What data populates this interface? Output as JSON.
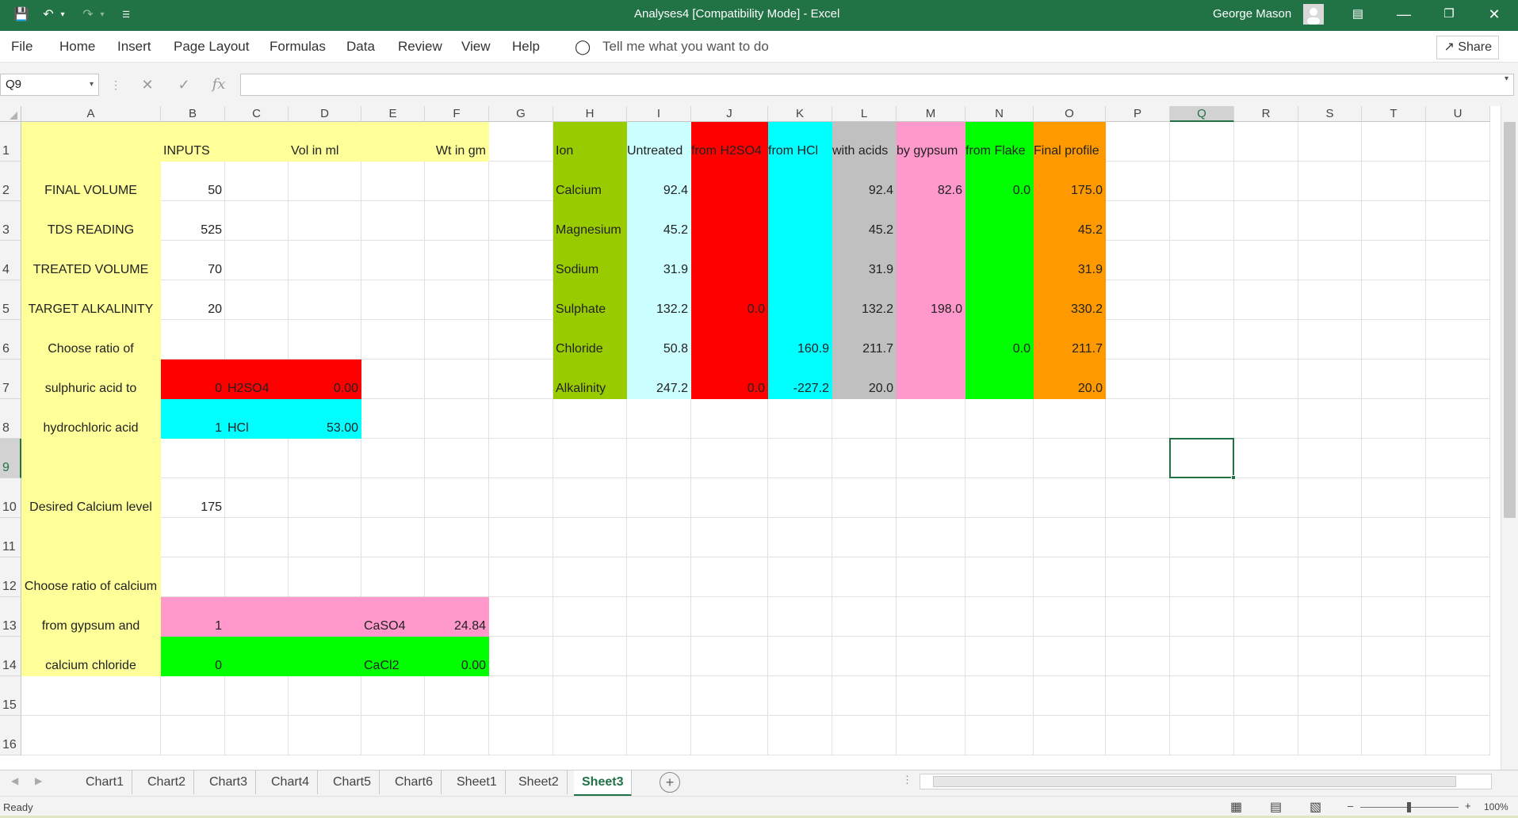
{
  "window": {
    "title": "Analyses4  [Compatibility Mode]  -  Excel",
    "user": "George Mason"
  },
  "menu": {
    "file": "File",
    "home": "Home",
    "insert": "Insert",
    "page_layout": "Page Layout",
    "formulas": "Formulas",
    "data": "Data",
    "review": "Review",
    "view": "View",
    "help": "Help",
    "tell_me": "Tell me what you want to do",
    "share": "Share"
  },
  "formula_bar": {
    "name_box": "Q9",
    "formula": ""
  },
  "columns": [
    "A",
    "B",
    "C",
    "D",
    "E",
    "F",
    "G",
    "H",
    "I",
    "J",
    "K",
    "L",
    "M",
    "N",
    "O",
    "P",
    "Q",
    "R",
    "S",
    "T",
    "U"
  ],
  "rows": [
    "1",
    "2",
    "3",
    "4",
    "5",
    "6",
    "7",
    "8",
    "9",
    "10",
    "11",
    "12",
    "13",
    "14",
    "15",
    "16"
  ],
  "selected_cell": "Q9",
  "cells": {
    "B1": "INPUTS",
    "D1": "Vol in ml",
    "F1": "Wt in gm",
    "A2": "FINAL VOLUME",
    "B2": "50",
    "A3": "TDS READING",
    "B3": "525",
    "A4": "TREATED VOLUME",
    "B4": "70",
    "A5": "TARGET ALKALINITY",
    "B5": "20",
    "A6": "Choose ratio of",
    "A7": "sulphuric acid to",
    "B7": "0",
    "C7": "H2SO4",
    "D7": "0.00",
    "A8": "hydrochloric acid",
    "B8": "1",
    "C8": "HCl",
    "D8": "53.00",
    "A10": "Desired Calcium level",
    "B10": "175",
    "A12": "Choose ratio of calcium",
    "A13": "from gypsum and",
    "B13": "1",
    "E13": "CaSO4",
    "F13": "24.84",
    "A14": "calcium chloride",
    "B14": "0",
    "E14": "CaCl2",
    "F14": "0.00",
    "H1": "Ion",
    "I1": "Untreated",
    "J1": "from H2SO4",
    "K1": "from HCl",
    "L1": "with acids",
    "M1": "by gypsum",
    "N1": "from Flake",
    "O1": "Final profile",
    "H2": "Calcium",
    "I2": "92.4",
    "L2": "92.4",
    "M2": "82.6",
    "N2": "0.0",
    "O2": "175.0",
    "H3": "Magnesium",
    "I3": "45.2",
    "L3": "45.2",
    "O3": "45.2",
    "H4": "Sodium",
    "I4": "31.9",
    "L4": "31.9",
    "O4": "31.9",
    "H5": "Sulphate",
    "I5": "132.2",
    "J5": "0.0",
    "L5": "132.2",
    "M5": "198.0",
    "O5": "330.2",
    "H6": "Chloride",
    "I6": "50.8",
    "K6": "160.9",
    "L6": "211.7",
    "N6": "0.0",
    "O6": "211.7",
    "H7": "Alkalinity",
    "I7": "247.2",
    "J7": "0.0",
    "K7": "-227.2",
    "L7": "20.0",
    "O7": "20.0"
  },
  "colors": {
    "accent": "#217346",
    "yellow": "#ffff99",
    "red": "#ff0000",
    "cyan": "#00ffff",
    "pink": "#ff99cc",
    "green": "#00ff00",
    "olive": "#99cc00",
    "lightcyan": "#ccffff",
    "gray": "#c0c0c0",
    "orange": "#ff9900"
  },
  "sheets": [
    "Chart1",
    "Chart2",
    "Chart3",
    "Chart4",
    "Chart5",
    "Chart6",
    "Sheet1",
    "Sheet2",
    "Sheet3"
  ],
  "active_sheet": "Sheet3",
  "status": {
    "text": "Ready",
    "zoom": "100%"
  }
}
